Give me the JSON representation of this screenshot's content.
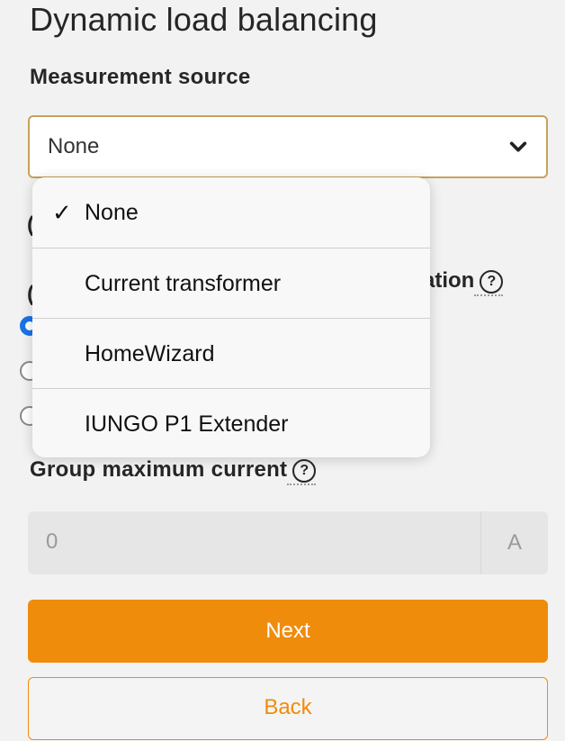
{
  "page": {
    "title": "Dynamic load balancing"
  },
  "measurement": {
    "label": "Measurement source",
    "selected_value": "None",
    "options": [
      {
        "label": "None",
        "selected": true
      },
      {
        "label": "Current transformer",
        "selected": false
      },
      {
        "label": "HomeWizard",
        "selected": false
      },
      {
        "label": "IUNGO P1 Extender",
        "selected": false
      }
    ],
    "check_glyph": "✓"
  },
  "obscured": {
    "partial_label": "ation",
    "help_glyph": "?"
  },
  "group_max": {
    "label": "Group maximum current",
    "help_glyph": "?",
    "placeholder": "0",
    "unit": "A"
  },
  "buttons": {
    "next": "Next",
    "back": "Back"
  },
  "colors": {
    "accent": "#f08c0c",
    "select_border": "#c8a25c",
    "radio_checked": "#1a73e8"
  },
  "icons": {
    "select_arrow": "chevron-down-icon",
    "help": "help-circle-icon",
    "check": "checkmark-icon"
  }
}
